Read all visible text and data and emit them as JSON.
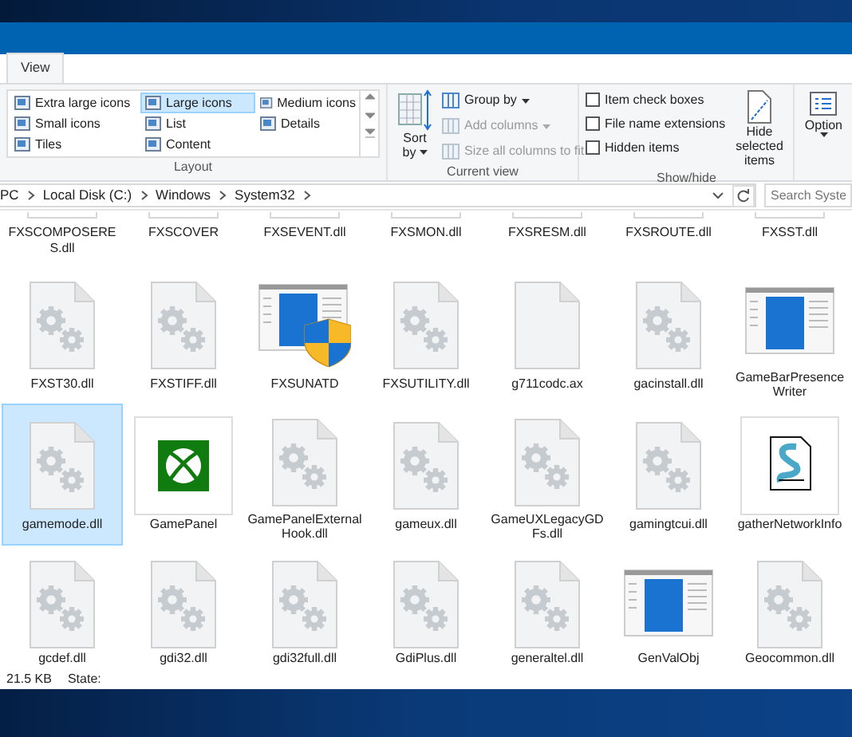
{
  "tabs": [
    {
      "label": "View",
      "selected": true
    }
  ],
  "ribbon": {
    "layout": {
      "title": "Layout",
      "options": [
        {
          "label": "Extra large icons",
          "selected": false
        },
        {
          "label": "Large icons",
          "selected": true
        },
        {
          "label": "Medium icons",
          "selected": false
        },
        {
          "label": "Small icons",
          "selected": false
        },
        {
          "label": "List",
          "selected": false
        },
        {
          "label": "Details",
          "selected": false
        },
        {
          "label": "Tiles",
          "selected": false
        },
        {
          "label": "Content",
          "selected": false
        }
      ]
    },
    "current_view": {
      "title": "Current view",
      "sort": {
        "line1": "Sort",
        "line2": "by"
      },
      "commands": [
        {
          "label": "Group by",
          "disabled": false
        },
        {
          "label": "Add columns",
          "disabled": true
        },
        {
          "label": "Size all columns to fit",
          "disabled": true
        }
      ]
    },
    "show_hide": {
      "title": "Show/hide",
      "checkboxes": [
        {
          "label": "Item check boxes",
          "checked": false
        },
        {
          "label": "File name extensions",
          "checked": false
        },
        {
          "label": "Hidden items",
          "checked": false
        }
      ],
      "hide_selected": {
        "line1": "Hide selected",
        "line2": "items"
      }
    },
    "options": {
      "label": "Option"
    }
  },
  "address": {
    "path": [
      "PC",
      "Local Disk (C:)",
      "Windows",
      "System32"
    ],
    "search_placeholder": "Search Syste"
  },
  "files": [
    {
      "name": "FXSCOMPOSERES.dll",
      "kind": "cut",
      "selected": false
    },
    {
      "name": "FXSCOVER",
      "kind": "cut",
      "selected": false
    },
    {
      "name": "FXSEVENT.dll",
      "kind": "cut",
      "selected": false
    },
    {
      "name": "FXSMON.dll",
      "kind": "cut",
      "selected": false
    },
    {
      "name": "FXSRESM.dll",
      "kind": "cut",
      "selected": false
    },
    {
      "name": "FXSROUTE.dll",
      "kind": "cut",
      "selected": false
    },
    {
      "name": "FXSST.dll",
      "kind": "cut",
      "selected": false
    },
    {
      "name": "FXST30.dll",
      "kind": "gear",
      "selected": false
    },
    {
      "name": "FXSTIFF.dll",
      "kind": "gear",
      "selected": false
    },
    {
      "name": "FXSUNATD",
      "kind": "shield-app",
      "selected": false
    },
    {
      "name": "FXSUTILITY.dll",
      "kind": "gear",
      "selected": false
    },
    {
      "name": "g711codc.ax",
      "kind": "blank",
      "selected": false
    },
    {
      "name": "gacinstall.dll",
      "kind": "gear",
      "selected": false
    },
    {
      "name": "GameBarPresenceWriter",
      "kind": "app",
      "selected": false
    },
    {
      "name": "gamemode.dll",
      "kind": "gear",
      "selected": true
    },
    {
      "name": "GamePanel",
      "kind": "xbox",
      "selected": false
    },
    {
      "name": "GamePanelExternalHook.dll",
      "kind": "gear",
      "selected": false
    },
    {
      "name": "gameux.dll",
      "kind": "gear",
      "selected": false
    },
    {
      "name": "GameUXLegacyGDFs.dll",
      "kind": "gear",
      "selected": false
    },
    {
      "name": "gamingtcui.dll",
      "kind": "gear",
      "selected": false
    },
    {
      "name": "gatherNetworkInfo",
      "kind": "script",
      "selected": false
    },
    {
      "name": "gcdef.dll",
      "kind": "gear",
      "selected": false
    },
    {
      "name": "gdi32.dll",
      "kind": "gear",
      "selected": false
    },
    {
      "name": "gdi32full.dll",
      "kind": "gear",
      "selected": false
    },
    {
      "name": "GdiPlus.dll",
      "kind": "gear",
      "selected": false
    },
    {
      "name": "generaltel.dll",
      "kind": "gear",
      "selected": false
    },
    {
      "name": "GenValObj",
      "kind": "app",
      "selected": false
    },
    {
      "name": "Geocommon.dll",
      "kind": "gear",
      "selected": false
    }
  ],
  "status_bar": {
    "size": "21.5 KB",
    "state": "State:"
  }
}
